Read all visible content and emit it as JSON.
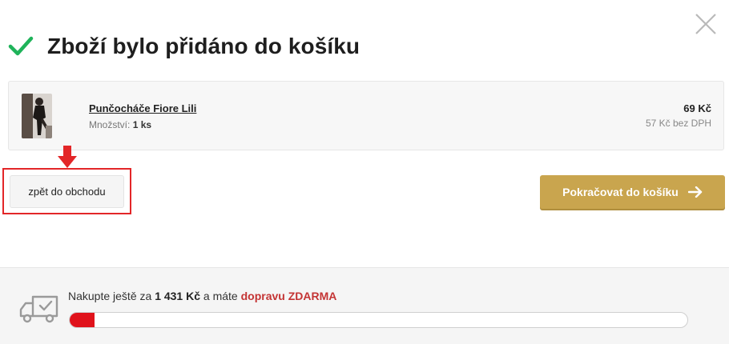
{
  "modal": {
    "title": "Zboží bylo přidáno do košíku"
  },
  "product": {
    "name": "Punčocháče Fiore Lili",
    "quantity_label": "Množství:",
    "quantity_value": "1 ks",
    "price": "69 Kč",
    "price_without_vat": "57 Kč bez DPH"
  },
  "actions": {
    "back_label": "zpět do obchodu",
    "continue_label": "Pokračovat do košíku"
  },
  "shipping": {
    "prefix": "Nakupte ještě za",
    "amount": "1 431 Kč",
    "middle": "a máte",
    "free_label": "dopravu ZDARMA",
    "progress_percent": 4
  },
  "colors": {
    "accent_gold": "#c9a54e",
    "success_green": "#1fb35a",
    "progress_red": "#e0121b",
    "highlight_red": "#e32628"
  },
  "icons": {
    "success": "check-icon",
    "close": "close-icon",
    "continue": "arrow-right-icon",
    "shipping": "truck-icon",
    "hint": "arrow-down-icon"
  }
}
